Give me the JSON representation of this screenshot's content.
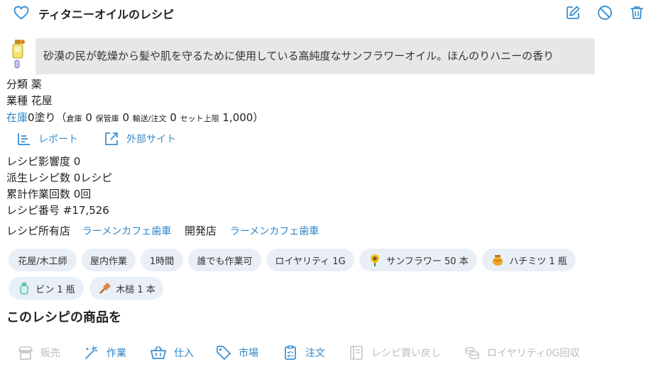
{
  "header": {
    "title": "ティタニーオイルのレシピ"
  },
  "item": {
    "description": "砂漠の民が乾燥から髪や肌を守るために使用している高純度なサンフラワーオイル。ほんのりハニーの香り"
  },
  "info": {
    "category_label": "分類",
    "category_value": "薬",
    "industry_label": "業種",
    "industry_value": "花屋",
    "stock_link": "在庫",
    "stock_value": "0塗り（",
    "warehouse_label": "倉庫",
    "warehouse_value": "0",
    "storage_label": "保管庫",
    "storage_value": "0",
    "transport_label": "輸送/注文",
    "transport_value": "0",
    "set_limit_label": "セット上限",
    "set_limit_value": "1,000）"
  },
  "actions": {
    "report": "レポート",
    "external_site": "外部サイト"
  },
  "stats": {
    "influence": "レシピ影響度 0",
    "derived": "派生レシピ数 0レシピ",
    "total_work": "累計作業回数 0回",
    "recipe_number": "レシピ番号 #17,526"
  },
  "owner": {
    "owner_label": "レシピ所有店",
    "owner_shop": "ラーメンカフェ歯車",
    "dev_label": "開発店",
    "dev_shop": "ラーメンカフェ歯車"
  },
  "tags": [
    "花屋/木工師",
    "屋内作業",
    "1時間",
    "誰でも作業可",
    "ロイヤリティ 1G",
    "サンフラワー 50 本",
    "ハチミツ 1 瓶",
    "ビン 1 瓶",
    "木槌 1 本"
  ],
  "section": {
    "title": "このレシピの商品を"
  },
  "bottom_actions": {
    "sell": "販売",
    "work": "作業",
    "purchase": "仕入",
    "market": "市場",
    "order": "注文",
    "buyback": "レシピ買い戻し",
    "royalty": "ロイヤリティ0G回収"
  },
  "colors": {
    "accent": "#2e86c8",
    "pill_bg": "#e9eff6",
    "desc_bg": "#e7e7e7",
    "disabled": "#bdbdbd"
  },
  "icons": {
    "heart": "heart-outline-icon",
    "edit": "pencil-square-icon",
    "ban": "ban-icon",
    "trash": "trash-icon"
  }
}
